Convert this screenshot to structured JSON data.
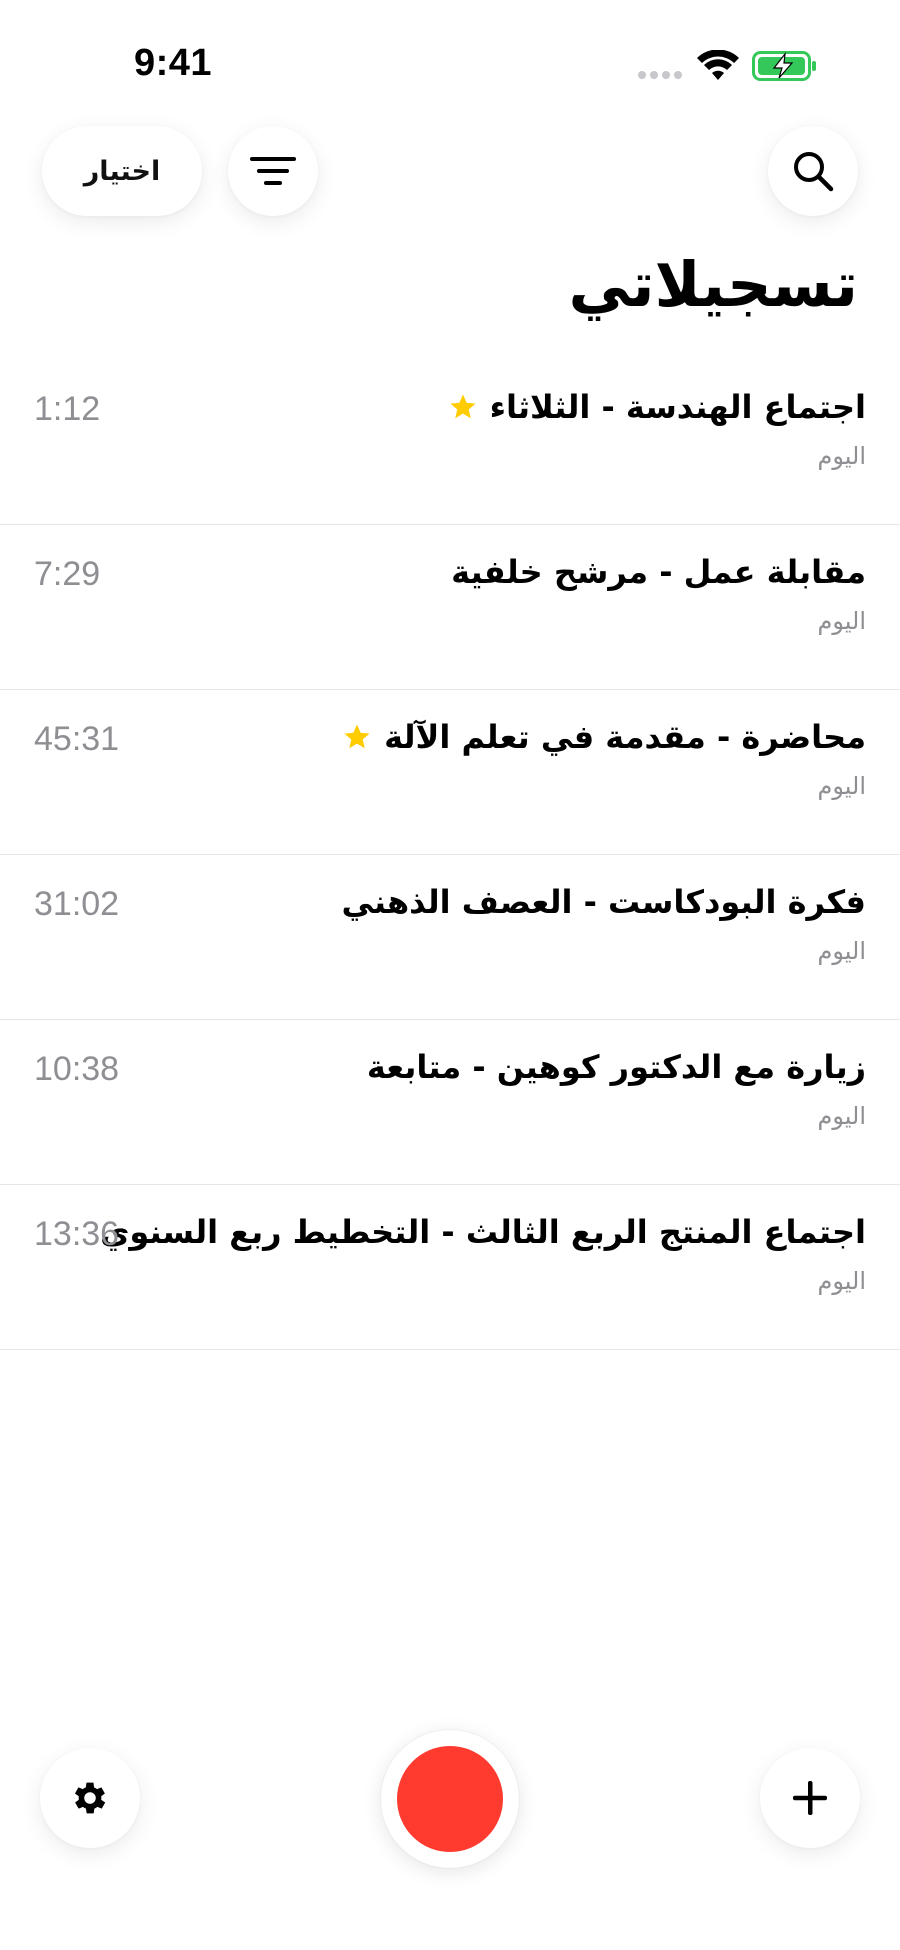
{
  "status_bar": {
    "time": "9:41",
    "icons": [
      "signal-dots-icon",
      "wifi-icon",
      "battery-charging-icon"
    ],
    "battery_color": "#34c759"
  },
  "toolbar": {
    "select_label": "اختيار",
    "filter_icon": "filter-lines-icon",
    "search_icon": "search-icon"
  },
  "page": {
    "title": "تسجيلاتي"
  },
  "recordings": [
    {
      "title": "اجتماع الهندسة - الثلاثاء",
      "date": "اليوم",
      "duration": "1:12",
      "starred": true
    },
    {
      "title": "مقابلة عمل - مرشح خلفية",
      "date": "اليوم",
      "duration": "7:29",
      "starred": false
    },
    {
      "title": "محاضرة - مقدمة في تعلم الآلة",
      "date": "اليوم",
      "duration": "45:31",
      "starred": true
    },
    {
      "title": "فكرة البودكاست - العصف الذهني",
      "date": "اليوم",
      "duration": "31:02",
      "starred": false
    },
    {
      "title": "زيارة مع الدكتور كوهين - متابعة",
      "date": "اليوم",
      "duration": "10:38",
      "starred": false
    },
    {
      "title": "اجتماع المنتج الربع الثالث - التخطيط ربع السنوي",
      "date": "اليوم",
      "duration": "13:36",
      "starred": false
    }
  ],
  "bottom_bar": {
    "settings_icon": "gear-icon",
    "record_icon": "record-icon",
    "add_icon": "plus-icon"
  },
  "colors": {
    "accent_record": "#ff3b30",
    "star": "#ffcc00",
    "secondary_text": "#8e8e93"
  }
}
